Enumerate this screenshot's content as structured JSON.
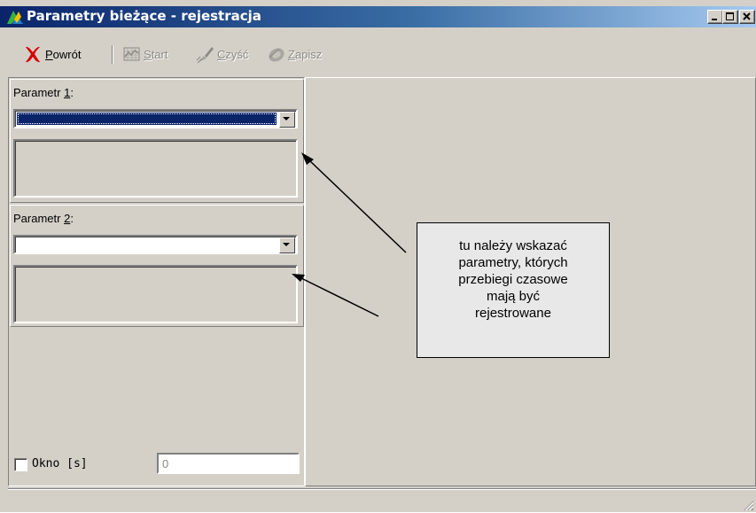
{
  "window": {
    "title": "Parametry bieżące - rejestracja",
    "controls": [
      "minimize",
      "maximize",
      "close"
    ],
    "app_icon": "app-logo-icon"
  },
  "toolbar": {
    "back": {
      "pre": "",
      "key": "P",
      "post": "owrót",
      "icon": "red-x-icon",
      "enabled": true
    },
    "start": {
      "pre": "",
      "key": "S",
      "post": "tart",
      "icon": "chart-icon",
      "enabled": false
    },
    "clear": {
      "pre": "",
      "key": "C",
      "post": "zyść",
      "icon": "brush-icon",
      "enabled": false
    },
    "save": {
      "pre": "",
      "key": "Z",
      "post": "apisz",
      "icon": "disk-icon",
      "enabled": false
    }
  },
  "param1": {
    "label_pre": "Parametr ",
    "label_key": "1",
    "label_post": ":",
    "value": ""
  },
  "param2": {
    "label_pre": "Parametr ",
    "label_key": "2",
    "label_post": ":",
    "value": ""
  },
  "window_option": {
    "label": "Okno [s]",
    "checked": false,
    "value": "0"
  },
  "callout": {
    "lines": [
      "tu należy wskazać",
      "parametry, których",
      "przebiegi czasowe",
      "mają być",
      "rejestrowane"
    ]
  },
  "colors": {
    "face": "#d4d0c8",
    "selection": "#0a246a",
    "title_start": "#0a246a",
    "title_end": "#a6caf0",
    "callout_bg": "#e8e8e8"
  }
}
